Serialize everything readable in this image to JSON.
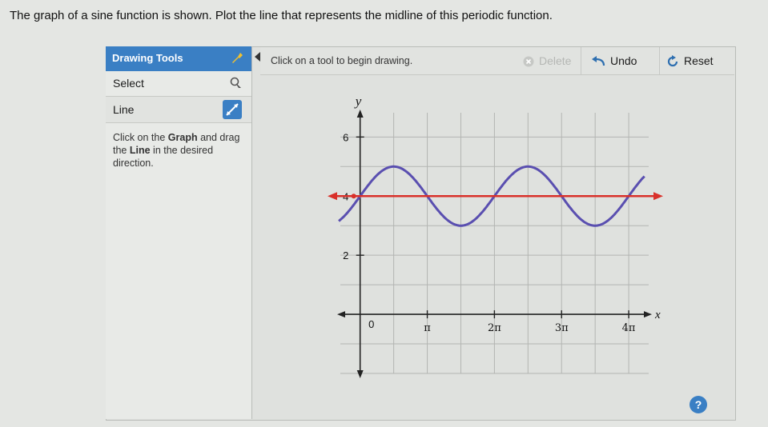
{
  "question": "The graph of a sine function is shown. Plot the line that represents the midline of this periodic function.",
  "tools": {
    "header": "Drawing Tools",
    "items": [
      {
        "label": "Select",
        "icon": "select-cursor-icon"
      },
      {
        "label": "Line",
        "icon": "line-tool-icon",
        "active": true
      }
    ],
    "hint": {
      "t1": "Click on the ",
      "b1": "Graph",
      "t2": " and drag the ",
      "b2": "Line",
      "t3": " in the desired direction."
    }
  },
  "toolbar": {
    "prompt": "Click on a tool to begin drawing.",
    "delete": "Delete",
    "undo": "Undo",
    "reset": "Reset"
  },
  "graph": {
    "x_axis_label": "x",
    "y_axis_label": "y",
    "y_ticks": [
      {
        "value": 2,
        "label": "2"
      },
      {
        "value": 4,
        "label": "4"
      },
      {
        "value": 6,
        "label": "6"
      }
    ],
    "x_ticks": [
      {
        "value": 3.14159,
        "label": "π"
      },
      {
        "value": 6.28318,
        "label": "2π"
      },
      {
        "value": 9.42478,
        "label": "3π"
      },
      {
        "value": 12.56637,
        "label": "4π"
      }
    ],
    "origin_label": "0",
    "x_range": [
      -1.3,
      13.5
    ],
    "y_range": [
      -2.0,
      7.2
    ],
    "curve": {
      "midline": 4,
      "amplitude": 1,
      "phase_start": -1.0,
      "end": 13.3,
      "color": "#5a4fb0"
    },
    "drawn_line": {
      "y": 4,
      "color": "#d9302a"
    },
    "grid_color": "#b3b5b2"
  },
  "help_label": "?"
}
